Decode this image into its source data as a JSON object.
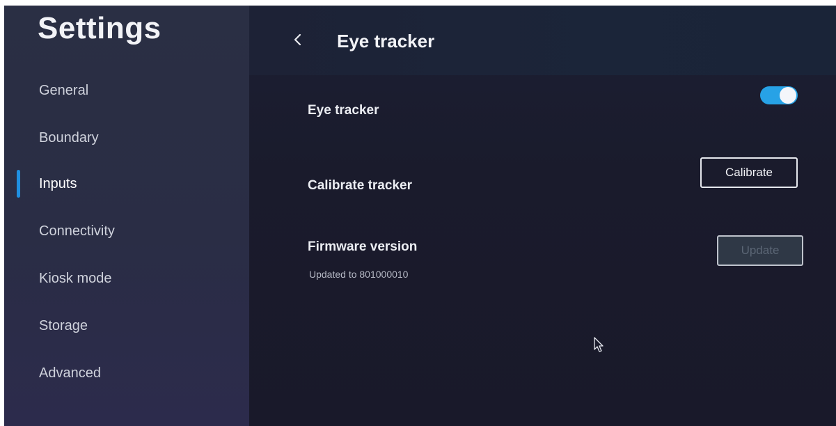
{
  "sidebar": {
    "title": "Settings",
    "items": [
      {
        "label": "General",
        "active": false
      },
      {
        "label": "Boundary",
        "active": false
      },
      {
        "label": "Inputs",
        "active": true
      },
      {
        "label": "Connectivity",
        "active": false
      },
      {
        "label": "Kiosk mode",
        "active": false
      },
      {
        "label": "Storage",
        "active": false
      },
      {
        "label": "Advanced",
        "active": false
      }
    ]
  },
  "header": {
    "back_icon": "chevron-left-icon",
    "title": "Eye tracker"
  },
  "settings": {
    "eye_tracker": {
      "label": "Eye tracker",
      "toggle_on": true
    },
    "calibrate": {
      "label": "Calibrate tracker",
      "button_label": "Calibrate"
    },
    "firmware": {
      "label": "Firmware version",
      "status": "Updated to 801000010",
      "button_label": "Update",
      "button_enabled": false
    }
  },
  "colors": {
    "accent": "#27a2e6",
    "indicator": "#1f8fe0",
    "sidebar_bg": "#2a2f44",
    "main_bg": "#191a2a"
  }
}
